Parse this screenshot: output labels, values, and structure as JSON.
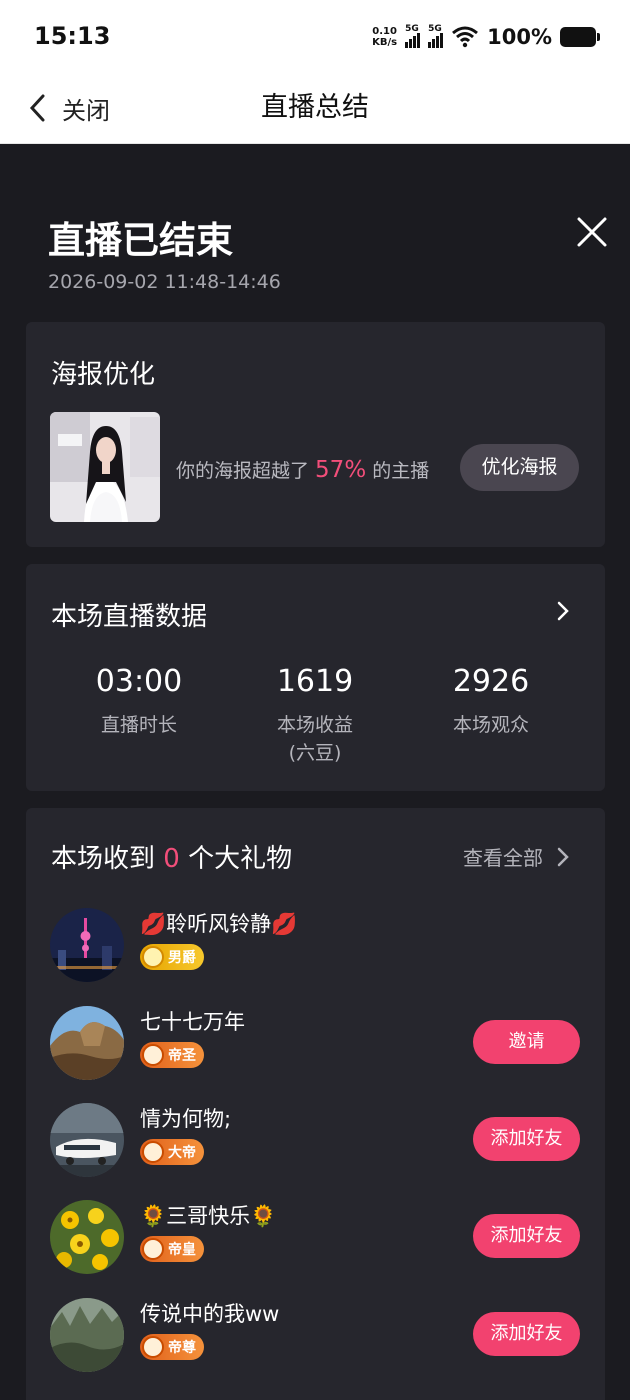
{
  "status_bar": {
    "time": "15:13",
    "net_speed_value": "0.10",
    "net_speed_unit": "KB/s",
    "sim1": "5G",
    "sim2": "5G",
    "battery": "100%"
  },
  "nav": {
    "back_label": "关闭",
    "title": "直播总结"
  },
  "summary": {
    "title": "直播已结束",
    "time_range": "2026-09-02 11:48-14:46"
  },
  "poster": {
    "title": "海报优化",
    "text_before": "你的海报超越了 ",
    "percent": "57%",
    "text_after": " 的主播",
    "button_label": "优化海报"
  },
  "stats": {
    "title": "本场直播数据",
    "items": [
      {
        "value": "03:00",
        "label": "直播时长",
        "sublabel": ""
      },
      {
        "value": "1619",
        "label": "本场收益",
        "sublabel": "(六豆)"
      },
      {
        "value": "2926",
        "label": "本场观众",
        "sublabel": ""
      }
    ]
  },
  "gifts": {
    "title_before": "本场收到",
    "count": "0",
    "title_after": "个大礼物",
    "view_all": "查看全部",
    "users": [
      {
        "name": "💋聆听风铃静💋",
        "badge": "男爵",
        "action": ""
      },
      {
        "name": "七十七万年",
        "badge": "帝圣",
        "action": "邀请"
      },
      {
        "name": "情为何物;",
        "badge": "大帝",
        "action": "添加好友"
      },
      {
        "name": "🌻三哥快乐🌻",
        "badge": "帝皇",
        "action": "添加好友"
      },
      {
        "name": "传说中的我ww",
        "badge": "帝尊",
        "action": "添加好友"
      }
    ]
  },
  "colors": {
    "background": "#1b1b20",
    "card": "#26262d",
    "accent_pink": "#f24e7a",
    "button_pink": "#f2426f"
  }
}
